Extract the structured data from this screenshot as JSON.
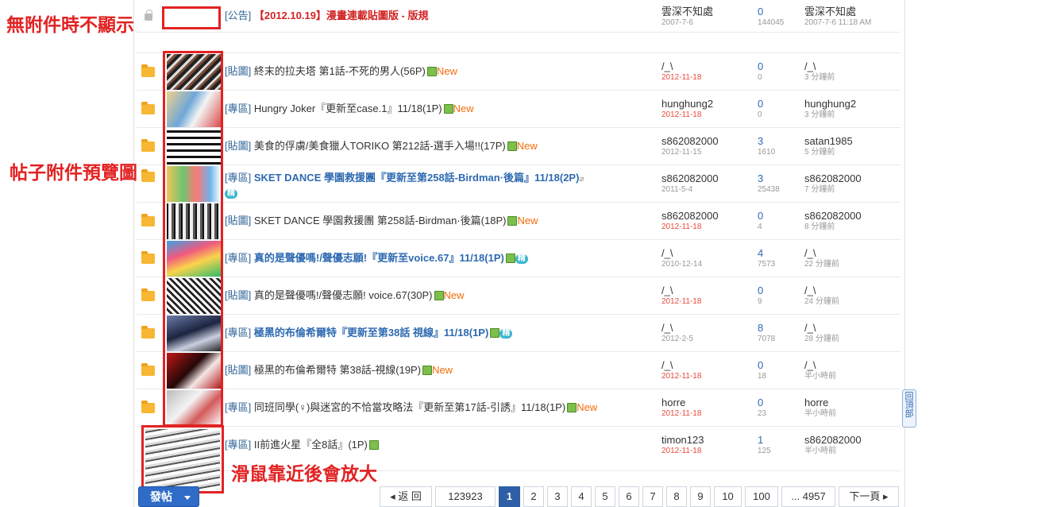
{
  "annotations": {
    "no_attachment": "無附件時不顯示",
    "preview": "帖子附件預覽圖",
    "hover_zoom": "滑鼠靠近後會放大"
  },
  "threads": [
    {
      "cat": "[公告]",
      "title": "【2012.10.19】漫畫連載貼圖版 - 版規",
      "author": "雲深不知處",
      "date": "2007-7-6",
      "replies": "0",
      "views": "144045",
      "last_user": "雲深不知處",
      "last_time": "2007-7-6 11:18 AM"
    },
    {
      "cat": "[貼圖]",
      "title": "終末的拉夫塔 第1話-不死的男人(56P)",
      "new": "New",
      "author": "/_\\",
      "date": "2012-11-18",
      "replies": "0",
      "views": "0",
      "last_user": "/_\\",
      "last_time": "3 分鐘前"
    },
    {
      "cat": "[專區]",
      "title": "Hungry Joker『更新至case.1』11/18(1P)",
      "new": "New",
      "author": "hunghung2",
      "date": "2012-11-18",
      "replies": "0",
      "views": "0",
      "last_user": "hunghung2",
      "last_time": "3 分鐘前"
    },
    {
      "cat": "[貼圖]",
      "title": "美食的俘虜/美食獵人TORIKO 第212話-選手入場!!(17P)",
      "new": "New",
      "author": "s862082000",
      "date": "2012-11-15",
      "replies": "3",
      "views": "1610",
      "last_user": "satan1985",
      "last_time": "5 分鐘前"
    },
    {
      "cat": "[專區]",
      "title": "SKET DANCE 學園救援團『更新至第258話-Birdman·後篇』11/18(2P)",
      "jing": "精",
      "author": "s862082000",
      "date": "2011-5-4",
      "replies": "3",
      "views": "25438",
      "last_user": "s862082000",
      "last_time": "7 分鐘前"
    },
    {
      "cat": "[貼圖]",
      "title": "SKET DANCE 學園救援團 第258話-Birdman·後篇(18P)",
      "new": "New",
      "author": "s862082000",
      "date": "2012-11-18",
      "replies": "0",
      "views": "4",
      "last_user": "s862082000",
      "last_time": "8 分鐘前"
    },
    {
      "cat": "[專區]",
      "title": "真的是聲優嗎!/聲優志願!『更新至voice.67』11/18(1P)",
      "jing": "精",
      "author": "/_\\",
      "date": "2010-12-14",
      "replies": "4",
      "views": "7573",
      "last_user": "/_\\",
      "last_time": "22 分鐘前"
    },
    {
      "cat": "[貼圖]",
      "title": "真的是聲優嗎!/聲優志願! voice.67(30P)",
      "new": "New",
      "author": "/_\\",
      "date": "2012-11-18",
      "replies": "0",
      "views": "9",
      "last_user": "/_\\",
      "last_time": "24 分鐘前"
    },
    {
      "cat": "[專區]",
      "title": "極黑的布倫希爾特『更新至第38話 視線』11/18(1P)",
      "jing": "精",
      "author": "/_\\",
      "date": "2012-2-5",
      "replies": "8",
      "views": "7078",
      "last_user": "/_\\",
      "last_time": "28 分鐘前"
    },
    {
      "cat": "[貼圖]",
      "title": "極黑的布倫希爾特 第38話-視線(19P)",
      "new": "New",
      "author": "/_\\",
      "date": "2012-11-18",
      "replies": "0",
      "views": "18",
      "last_user": "/_\\",
      "last_time": "半小時前"
    },
    {
      "cat": "[專區]",
      "title": "同班同學(♀)與迷宮的不恰當攻略法『更新至第17話-引誘』11/18(1P)",
      "new": "New",
      "author": "horre",
      "date": "2012-11-18",
      "replies": "0",
      "views": "23",
      "last_user": "horre",
      "last_time": "半小時前"
    },
    {
      "cat": "[專區]",
      "title": "II前進火星『全8話』(1P)",
      "author": "timon123",
      "date": "2012-11-18",
      "replies": "1",
      "views": "125",
      "last_user": "s862082000",
      "last_time": "半小時前"
    }
  ],
  "back_to_top": "回頂部",
  "post_button": "發帖",
  "pager": {
    "back": "返 回",
    "count": "123923",
    "pages": [
      "1",
      "2",
      "3",
      "4",
      "5",
      "6",
      "7",
      "8",
      "9",
      "10",
      "100"
    ],
    "last": "... 4957",
    "next": "下一頁"
  },
  "colors": {
    "accent": "#2e6ab1",
    "annotation": "#e22222",
    "new": "#f26c0c"
  }
}
